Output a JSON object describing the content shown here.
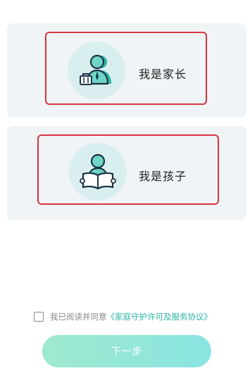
{
  "roles": {
    "parent": {
      "label": "我是家长",
      "icon": "parent-with-briefcase-icon"
    },
    "child": {
      "label": "我是孩子",
      "icon": "child-reading-book-icon"
    }
  },
  "agreement": {
    "prefix": "我已阅读并同意",
    "link_text": "《家庭守护许可及服务协议》",
    "checked": false
  },
  "next_button": {
    "label": "下一步"
  },
  "colors": {
    "accent": "#2bb5a5",
    "selection_border": "#d9343b",
    "card_background": "#f0f4f6",
    "avatar_background": "#d9eeee",
    "button_gradient_start": "#9fe9ce",
    "button_gradient_end": "#8ae4e2"
  }
}
